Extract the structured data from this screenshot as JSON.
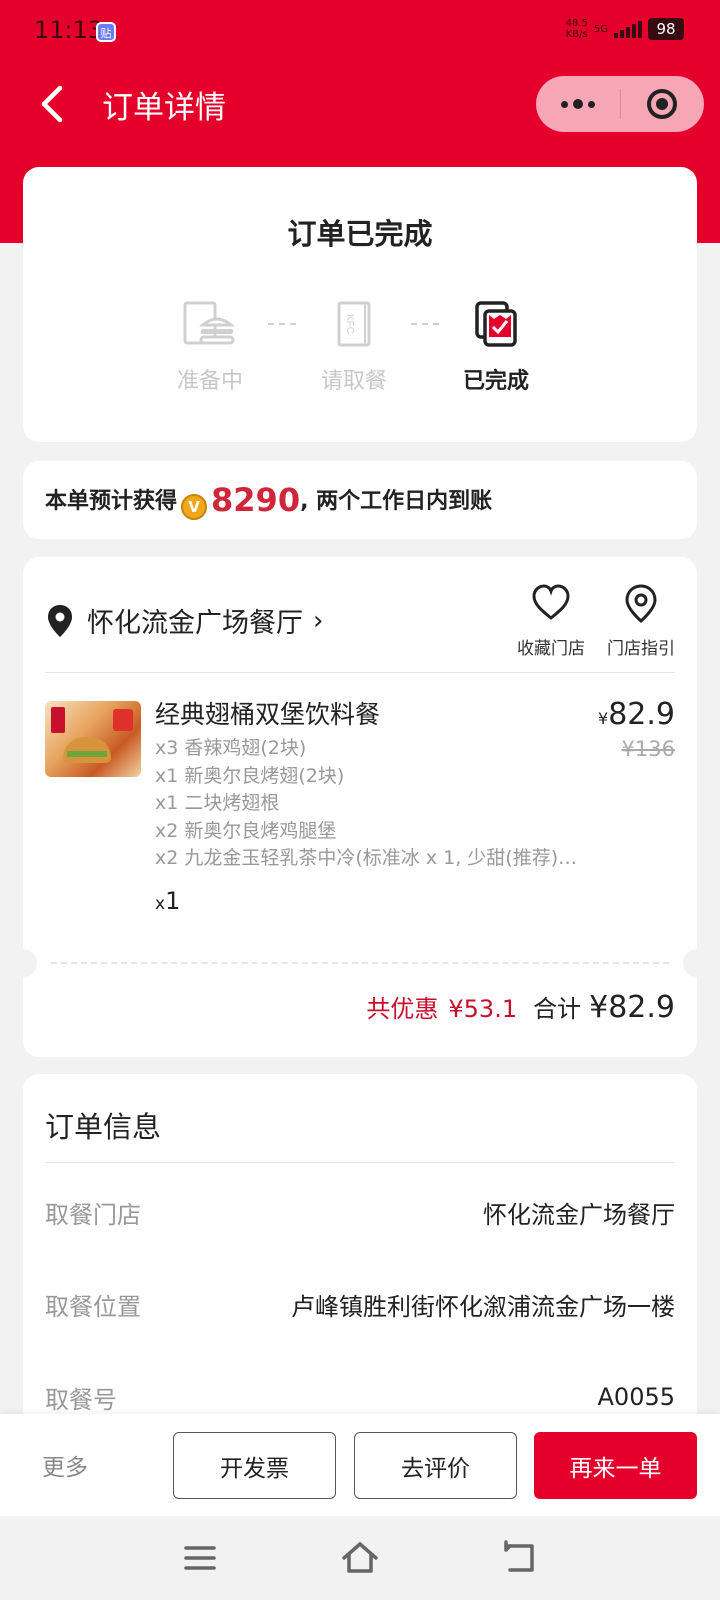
{
  "status_bar": {
    "time": "11:13",
    "app_badge": "贴",
    "net_speed_value": "48.5",
    "net_speed_unit": "KB/s",
    "network": "5G",
    "battery": "98"
  },
  "nav": {
    "title": "订单详情"
  },
  "order_status": {
    "heading": "订单已完成",
    "steps": [
      {
        "label": "准备中",
        "icon": "burger-tray-icon",
        "active": false
      },
      {
        "label": "请取餐",
        "icon": "kfc-bag-icon",
        "active": false
      },
      {
        "label": "已完成",
        "icon": "completed-check-icon",
        "active": true
      }
    ]
  },
  "points": {
    "prefix": "本单预计获得",
    "coin_letter": "V",
    "value": "8290",
    "suffix": ", 两个工作日内到账"
  },
  "store": {
    "name": "怀化流金广场餐厅",
    "favorite_label": "收藏门店",
    "guide_label": "门店指引"
  },
  "product": {
    "name": "经典翅桶双堡饮料餐",
    "items": [
      "x3 香辣鸡翅(2块)",
      "x1 新奥尔良烤翅(2块)",
      "x1 二块烤翅根",
      "x2 新奥尔良烤鸡腿堡",
      "x2 九龙金玉轻乳茶中冷(标准冰 x 1, 少甜(推荐)…"
    ],
    "qty_prefix": "x",
    "qty": "1",
    "currency": "¥",
    "price": "82.9",
    "original_price": "¥136"
  },
  "totals": {
    "discount_label": "共优惠",
    "discount_value": "¥53.1",
    "total_label": "合计",
    "total_value": "¥82.9"
  },
  "order_info": {
    "title": "订单信息",
    "rows": [
      {
        "key": "取餐门店",
        "value": "怀化流金广场餐厅"
      },
      {
        "key": "取餐位置",
        "value": "卢峰镇胜利街怀化溆浦流金广场一楼"
      },
      {
        "key": "取餐号",
        "value": "A0055"
      }
    ]
  },
  "actions": {
    "more": "更多",
    "invoice": "开发票",
    "review": "去评价",
    "reorder": "再来一单"
  },
  "colors": {
    "brand_red": "#e4002b",
    "discount_red": "#c8102e",
    "points_red": "#d0263a",
    "background": "#f2f2f2"
  }
}
